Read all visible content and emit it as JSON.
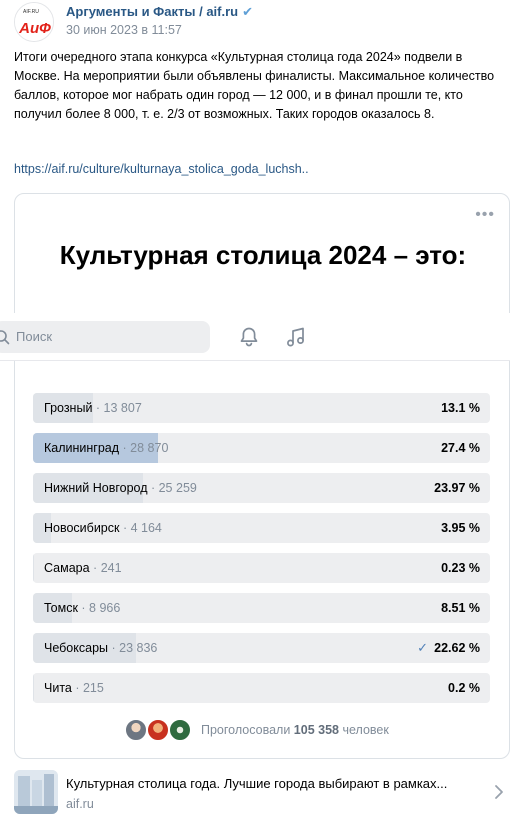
{
  "post": {
    "author": "Аргументы и Факты / aif.ru",
    "verified_icon": "verified-check-icon",
    "date": "30 июн 2023 в 11:57",
    "avatar_text": "АиФ",
    "avatar_small_text": "AIF.RU",
    "text": "Итоги очередного этапа конкурса «Культурная столица года 2024» подвели в Москве. На мероприятии были объявлены финалисты. Максимальное количество баллов, которое мог набрать один город — 12 000, и в финал прошли те, кто получил более 8 000, т. е. 2/3 от возможных. Таких городов оказалось 8.",
    "link": "https://aif.ru/culture/kulturnaya_stolica_goda_luchsh.."
  },
  "card": {
    "more_label": "•••",
    "title": "Культурная столица 2024 – это:"
  },
  "topbar": {
    "search_placeholder": "Поиск",
    "bell_icon": "bell-icon",
    "music_icon": "music-icon"
  },
  "poll": {
    "options": [
      {
        "name": "Грозный",
        "count": "13 807",
        "percent": "13.1 %",
        "share": 0.131,
        "chosen": false
      },
      {
        "name": "Калининград",
        "count": "28 870",
        "percent": "27.4 %",
        "share": 0.274,
        "chosen": true
      },
      {
        "name": "Нижний Новгород",
        "count": "25 259",
        "percent": "23.97 %",
        "share": 0.2397,
        "chosen": false
      },
      {
        "name": "Новосибирск",
        "count": "4 164",
        "percent": "3.95 %",
        "share": 0.0395,
        "chosen": false
      },
      {
        "name": "Самара",
        "count": "241",
        "percent": "0.23 %",
        "share": 0.0023,
        "chosen": false
      },
      {
        "name": "Томск",
        "count": "8 966",
        "percent": "8.51 %",
        "share": 0.0851,
        "chosen": false
      },
      {
        "name": "Чебоксары",
        "count": "23 836",
        "percent": "22.62 %",
        "share": 0.2262,
        "chosen": false,
        "checked": true
      },
      {
        "name": "Чита",
        "count": "215",
        "percent": "0.2 %",
        "share": 0.002,
        "chosen": false
      }
    ],
    "voters_prefix": "Проголосовали",
    "voters_total": "105 358",
    "voters_suffix": "человек"
  },
  "link_card": {
    "title": "Культурная столица года. Лучшие города выбирают в рамках...",
    "domain": "aif.ru",
    "chevron_icon": "chevron-right-icon"
  },
  "colors": {
    "link": "#2a5885",
    "muted": "#818c99",
    "poll_bg": "#edeef0",
    "poll_fill": "#dfe3e8",
    "poll_fill_chosen": "#b6c8de",
    "accent": "#5181b8",
    "aif_red": "#e2231a"
  }
}
